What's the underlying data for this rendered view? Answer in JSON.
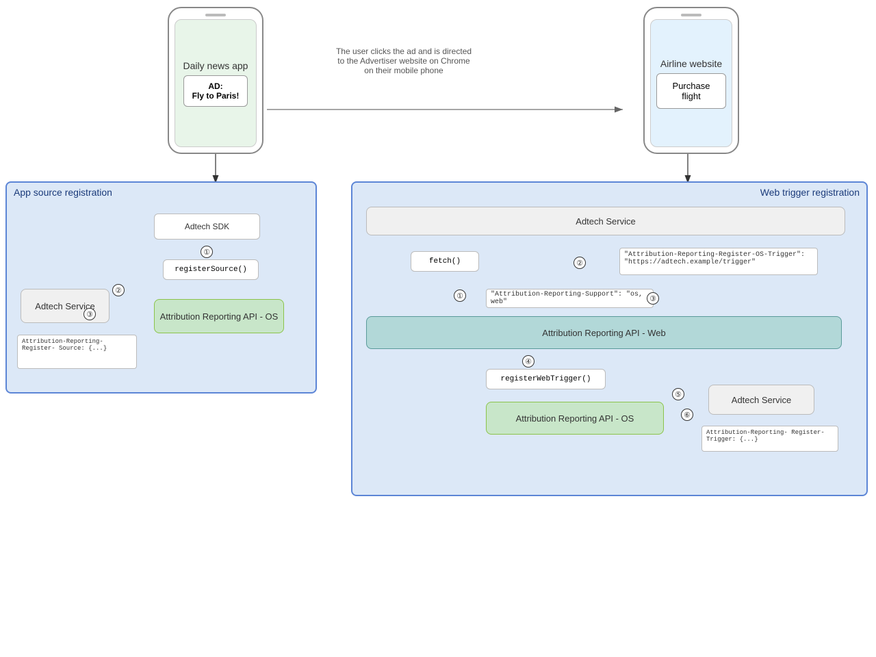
{
  "phones": {
    "left": {
      "title": "Daily news app",
      "ad_label": "AD:",
      "ad_text": "Fly to Paris!"
    },
    "right": {
      "title": "Airline website",
      "purchase_text": "Purchase flight"
    }
  },
  "description": "The user clicks the ad and is directed to the Advertiser website on Chrome on their mobile phone",
  "left_panel": {
    "title": "App source registration",
    "adtech_sdk": "Adtech SDK",
    "adtech_service": "Adtech Service",
    "register_source": "registerSource()",
    "attribution_os": "Attribution Reporting API - OS",
    "code_box": "Attribution-Reporting-Register-\nSource: {...}"
  },
  "right_panel": {
    "title": "Web trigger registration",
    "adtech_service_top": "Adtech Service",
    "fetch": "fetch()",
    "os_trigger": "\"Attribution-Reporting-Register-OS-Trigger\":\n\"https://adtech.example/trigger\"",
    "support": "\"Attribution-Reporting-Support\": \"os, web\"",
    "attribution_web": "Attribution Reporting API - Web",
    "register_web_trigger": "registerWebTrigger()",
    "attribution_os": "Attribution Reporting API - OS",
    "adtech_service_right": "Adtech Service",
    "code_box": "Attribution-Reporting-\nRegister-Trigger: {...}"
  },
  "step_numbers": [
    "①",
    "②",
    "③",
    "④",
    "⑤",
    "⑥"
  ]
}
